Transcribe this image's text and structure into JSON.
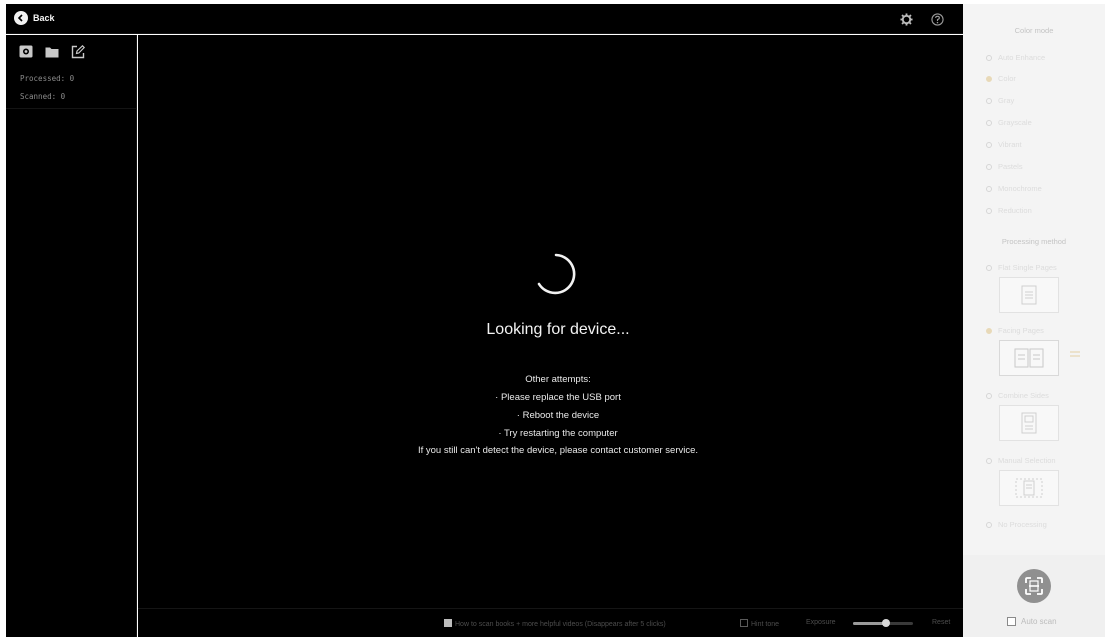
{
  "topbar": {
    "back_label": "Back",
    "icons": [
      "gear-icon",
      "help-icon"
    ]
  },
  "left_panel": {
    "tools": [
      "camera-icon",
      "folder-icon",
      "edit-icon"
    ],
    "processed": "Processed: 0",
    "scanned": "Scanned: 0"
  },
  "center": {
    "status": "Looking for device...",
    "attempts_title": "Other attempts:",
    "attempts": [
      "· Please replace the USB port",
      "· Reboot the device",
      "· Try restarting the computer"
    ],
    "contact": "If you still can't detect the device, please contact customer service."
  },
  "bottom_bar": {
    "tutorial_text": "How to scan books + more helpful videos (Disappears after 5 clicks)",
    "hint_tone_label": "Hint tone",
    "exposure_label": "Exposure",
    "exposure_value": 0.55,
    "reset_label": "Reset"
  },
  "right_panel": {
    "color_mode_title": "Color mode",
    "color_modes": [
      {
        "label": "Auto Enhance",
        "selected": false
      },
      {
        "label": "Color",
        "selected": true
      },
      {
        "label": "Gray",
        "selected": false
      },
      {
        "label": "Grayscale",
        "selected": false
      },
      {
        "label": "Vibrant",
        "selected": false
      },
      {
        "label": "Pastels",
        "selected": false
      },
      {
        "label": "Monochrome",
        "selected": false
      },
      {
        "label": "Reduction",
        "selected": false
      }
    ],
    "processing_title": "Processing method",
    "methods": [
      {
        "label": "Flat Single Pages",
        "selected": false,
        "icon": "single-page-icon"
      },
      {
        "label": "Facing Pages",
        "selected": true,
        "icon": "facing-pages-icon"
      },
      {
        "label": "Combine Sides",
        "selected": false,
        "icon": "combine-sides-icon"
      },
      {
        "label": "Manual Selection",
        "selected": false,
        "icon": "manual-selection-icon"
      },
      {
        "label": "No Processing",
        "selected": false
      }
    ],
    "auto_scan_label": "Auto scan"
  },
  "colors": {
    "background": "#000000",
    "panel_light": "#f4f4f4",
    "text_primary": "#f3f3f3",
    "accent_selected": "#e8d9b8"
  }
}
